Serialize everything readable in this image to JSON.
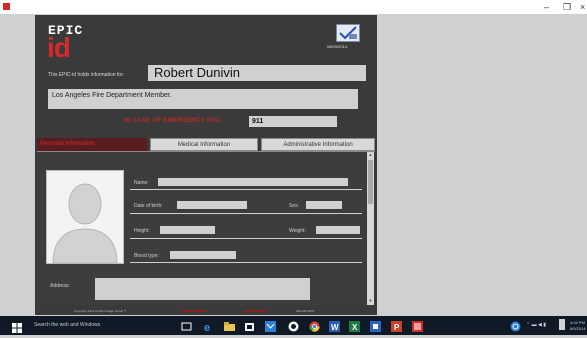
{
  "window": {
    "minimize_glyph": "–",
    "restore_glyph": "❐",
    "close_glyph": "×"
  },
  "header": {
    "logo_top": "EPIC",
    "logo_bottom": "id",
    "checkmark_date": "08/09/2014",
    "holds_label": "This EPIC-id holds information for:",
    "person_name": "Robert Dunivin",
    "description": "Los Angeles Fire Department Member.",
    "emergency_label": "IN CASE OF EMERGENCY DIAL",
    "emergency_number": "911"
  },
  "tabs": {
    "personal": "Personal Information",
    "medical": "Medical Information",
    "admin": "Administrative Information"
  },
  "personal": {
    "name_label": "Name:",
    "dob_label": "Date of birth:",
    "sex_label": "Sex:",
    "height_label": "Height:",
    "weight_label": "Weight:",
    "bloodtype_label": "Blood type:",
    "address_label": "Address:"
  },
  "footer": {
    "copyright": "Copyright 2014 Portfio Design Group™",
    "middle_red": "",
    "phone": "000-282-9627"
  },
  "taskbar": {
    "search_placeholder": "Search the web and Windows",
    "time": "4:04 PM",
    "date": "8/9/2014"
  },
  "colors": {
    "brand_red": "#d42a2a",
    "panel_dark": "#3a3a3a",
    "field_gray": "#d0d0d0"
  }
}
